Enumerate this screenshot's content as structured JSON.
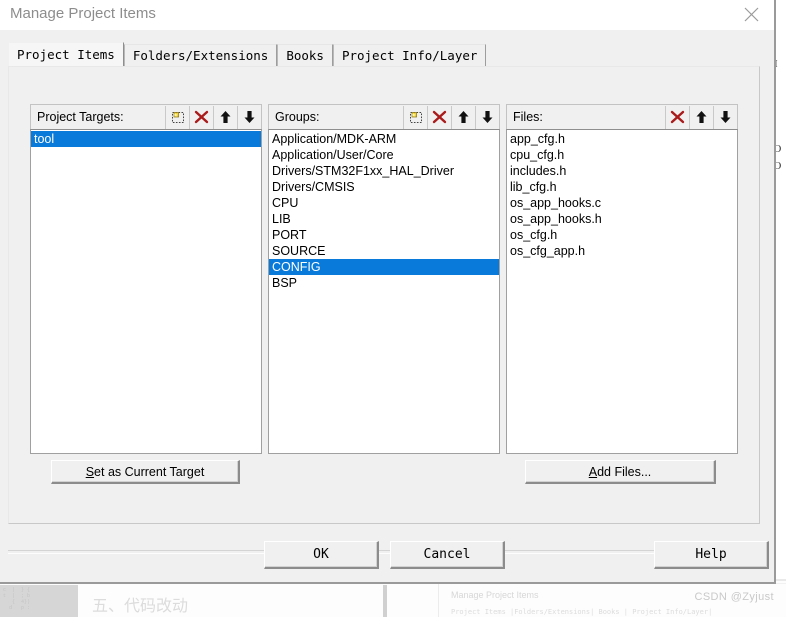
{
  "window": {
    "title": "Manage Project Items",
    "close_icon": "close-icon"
  },
  "tabs": [
    {
      "label": "Project Items",
      "active": true
    },
    {
      "label": "Folders/Extensions",
      "active": false
    },
    {
      "label": "Books",
      "active": false
    },
    {
      "label": "Project Info/Layer",
      "active": false
    }
  ],
  "columns": {
    "targets": {
      "label": "Project Targets:",
      "tools": [
        "new-item-icon",
        "delete-icon",
        "move-up-icon",
        "move-down-icon"
      ],
      "items": [
        "tool"
      ],
      "selected_index": 0
    },
    "groups": {
      "label": "Groups:",
      "tools": [
        "new-item-icon",
        "delete-icon",
        "move-up-icon",
        "move-down-icon"
      ],
      "items": [
        "Application/MDK-ARM",
        "Application/User/Core",
        "Drivers/STM32F1xx_HAL_Driver",
        "Drivers/CMSIS",
        "CPU",
        "LIB",
        "PORT",
        "SOURCE",
        "CONFIG",
        "BSP"
      ],
      "selected_index": 8
    },
    "files": {
      "label": "Files:",
      "tools": [
        "delete-icon",
        "move-up-icon",
        "move-down-icon"
      ],
      "items": [
        "app_cfg.h",
        "cpu_cfg.h",
        "includes.h",
        "lib_cfg.h",
        "os_app_hooks.c",
        "os_app_hooks.h",
        "os_cfg.h",
        "os_cfg_app.h"
      ],
      "selected_index": -1
    }
  },
  "actions": {
    "set_target": {
      "accel": "S",
      "rest": "et as Current Target"
    },
    "add_files": {
      "accel": "A",
      "rest": "dd Files..."
    }
  },
  "footer": {
    "ok": "OK",
    "cancel": "Cancel",
    "help": "Help"
  },
  "background": {
    "right_fragments": "SI\n\nOI\n\n\n\n\nRO\nRO\n_I\n;\n\n\n_I",
    "heading": "五、代码改动",
    "thumb_code": "c  |  } {\nt  |  ; b\n   {  4})\n  d   p :",
    "ghost_title": "Manage Project Items",
    "ghost_tabs": "Project Items |Folders/Extensions| Books | Project Info/Layer|",
    "watermark": "CSDN @Zyjust"
  },
  "colors": {
    "selection_blue": "#0a7ada",
    "dialog_face": "#f0f0f0",
    "delete_red": "#aa1b1b"
  }
}
